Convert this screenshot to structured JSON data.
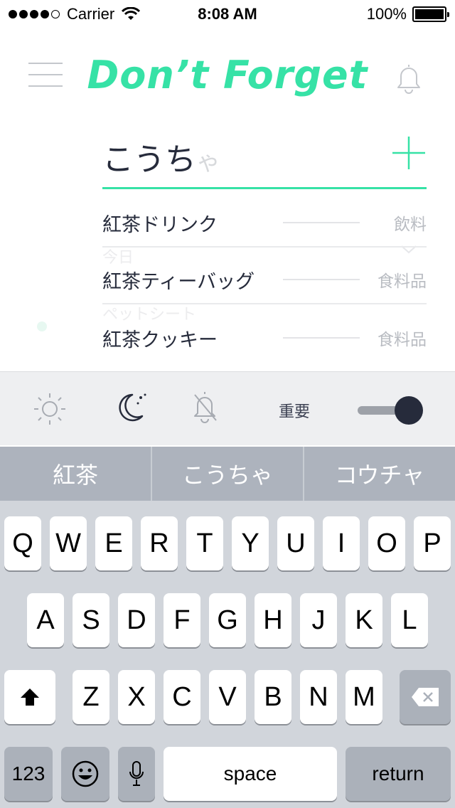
{
  "status_bar": {
    "carrier": "Carrier",
    "time": "8:08 AM",
    "battery": "100%"
  },
  "header": {
    "title": "Don’t Forget",
    "menu_icon": "hamburger-icon",
    "bell_icon": "bell-icon"
  },
  "input": {
    "value": "こうち",
    "composing": "ゃ",
    "add_icon": "plus-icon"
  },
  "suggestions": [
    {
      "name": "紅茶ドリンク",
      "category": "飲料"
    },
    {
      "name": "紅茶ティーバッグ",
      "category": "食料品"
    },
    {
      "name": "紅茶クッキー",
      "category": "食料品"
    }
  ],
  "background_items": [
    "今日",
    "ペットシート"
  ],
  "options": {
    "morning_icon": "sun-icon",
    "night_icon": "moon-icon",
    "mute_icon": "bell-off-icon",
    "important_label": "重要",
    "important_on": true
  },
  "keyboard": {
    "candidates": [
      "紅茶",
      "こうちゃ",
      "コウチャ"
    ],
    "row1": [
      "Q",
      "W",
      "E",
      "R",
      "T",
      "Y",
      "U",
      "I",
      "O",
      "P"
    ],
    "row2": [
      "A",
      "S",
      "D",
      "F",
      "G",
      "H",
      "J",
      "K",
      "L"
    ],
    "row3": [
      "Z",
      "X",
      "C",
      "V",
      "B",
      "N",
      "M"
    ],
    "numbers_label": "123",
    "space_label": "space",
    "return_label": "return"
  }
}
